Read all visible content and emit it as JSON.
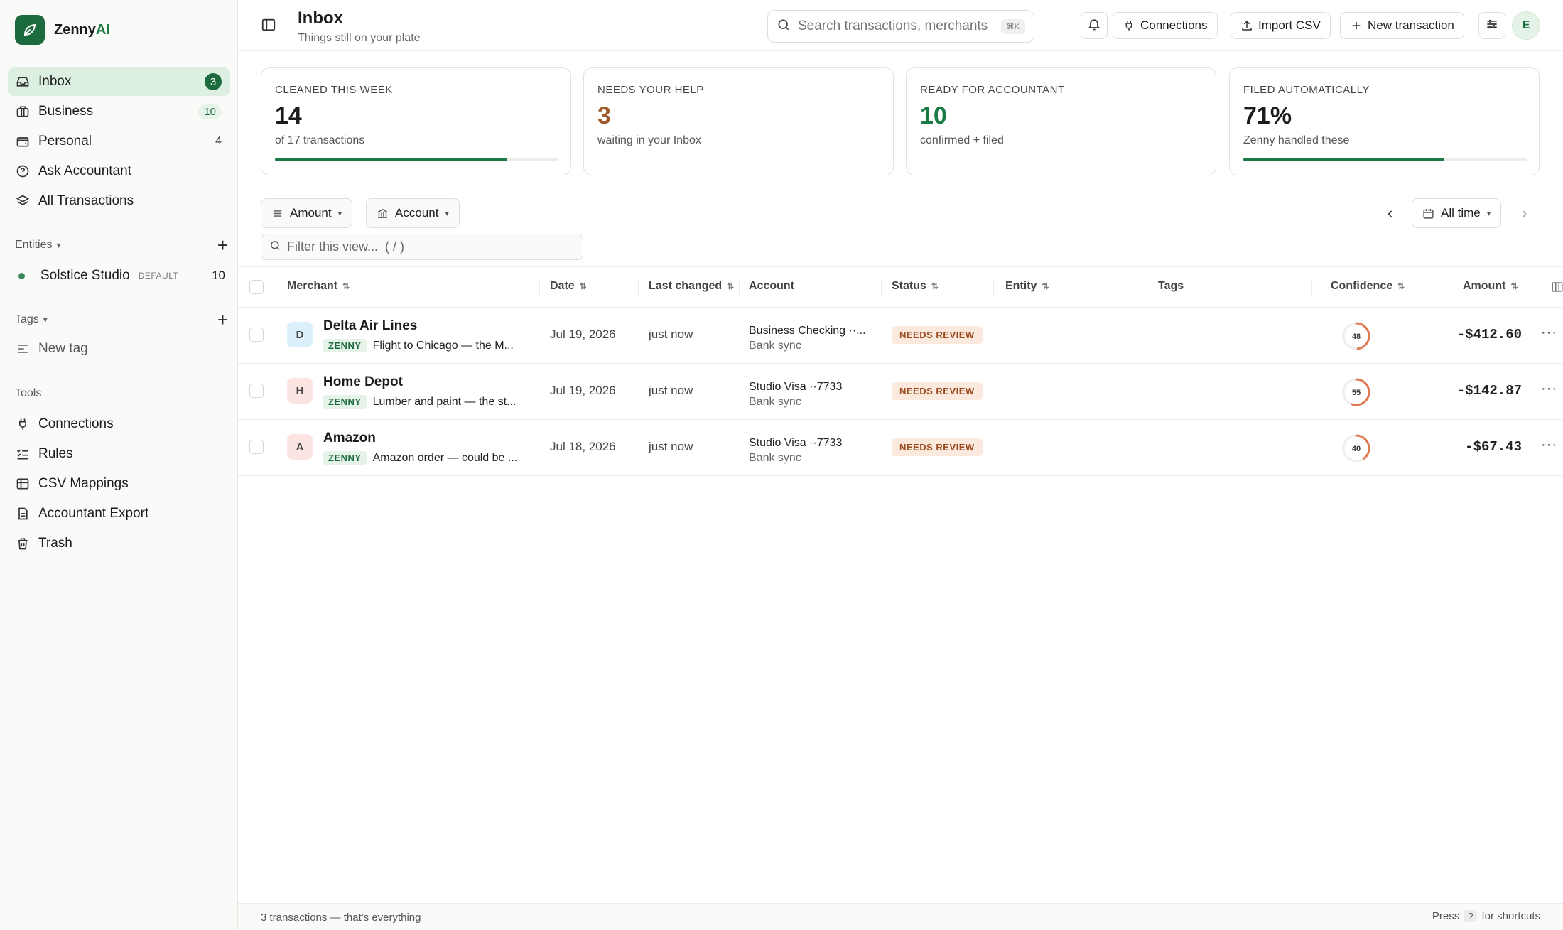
{
  "brand": {
    "name_prefix": "Zenny",
    "name_suffix": "AI"
  },
  "sidebar": {
    "nav": [
      {
        "label": "Inbox",
        "count": "3",
        "icon": "inbox-icon",
        "active": true
      },
      {
        "label": "Business",
        "count": "10",
        "icon": "briefcase-icon"
      },
      {
        "label": "Personal",
        "count": "4",
        "icon": "wallet-icon"
      },
      {
        "label": "Ask Accountant",
        "count": "",
        "icon": "help-circle-icon"
      },
      {
        "label": "All Transactions",
        "count": "",
        "icon": "layers-icon"
      }
    ],
    "entities_heading": "Entities",
    "entities": [
      {
        "name": "Solstice Studio",
        "tag": "DEFAULT",
        "count": "10"
      }
    ],
    "tags_heading": "Tags",
    "new_tag": "New tag",
    "tools_heading": "Tools",
    "tools": [
      {
        "label": "Connections",
        "icon": "plug-icon"
      },
      {
        "label": "Rules",
        "icon": "list-check-icon"
      },
      {
        "label": "CSV Mappings",
        "icon": "table-icon"
      },
      {
        "label": "Accountant Export",
        "icon": "file-icon"
      },
      {
        "label": "Trash",
        "icon": "trash-icon"
      }
    ]
  },
  "header": {
    "title": "Inbox",
    "subtitle": "Things still on your plate",
    "search_placeholder": "Search transactions, merchants",
    "search_kbd": "⌘K",
    "connections": "Connections",
    "import_csv": "Import CSV",
    "new_transaction": "New transaction",
    "avatar": "E"
  },
  "stats": [
    {
      "label": "CLEANED THIS WEEK",
      "value": "14",
      "sub": "of 17 transactions",
      "progress": 0.82,
      "value_color": "#1c1c1c"
    },
    {
      "label": "NEEDS YOUR HELP",
      "value": "3",
      "sub": "waiting in your Inbox",
      "value_color": "#a05a2c"
    },
    {
      "label": "READY FOR ACCOUNTANT",
      "value": "10",
      "sub": "confirmed + filed",
      "value_color": "#1b7a44"
    },
    {
      "label": "FILED AUTOMATICALLY",
      "value": "71%",
      "sub": "Zenny handled these",
      "progress": 0.71,
      "value_color": "#1c1c1c"
    }
  ],
  "filters": {
    "amount": "Amount",
    "account": "Account",
    "filter_placeholder": "Filter this view...  ( / )",
    "range": "All time"
  },
  "table": {
    "columns": {
      "merchant": "Merchant",
      "date": "Date",
      "last_changed": "Last changed",
      "account": "Account",
      "status": "Status",
      "entity": "Entity",
      "tags": "Tags",
      "confidence": "Confidence",
      "amount": "Amount"
    },
    "rows": [
      {
        "initial": "D",
        "avatar_bg": "#dcf0fb",
        "merchant": "Delta Air Lines",
        "tag": "ZENNY",
        "desc": "Flight to Chicago — the M...",
        "date": "Jul 19, 2026",
        "changed": "just now",
        "account": "Business Checking ··...",
        "source": "Bank sync",
        "status": "NEEDS REVIEW",
        "confidence": "48",
        "confidence_level": 0.48,
        "amount": "-$412.60"
      },
      {
        "initial": "H",
        "avatar_bg": "#fbe4e2",
        "merchant": "Home Depot",
        "tag": "ZENNY",
        "desc": "Lumber and paint — the st...",
        "date": "Jul 19, 2026",
        "changed": "just now",
        "account": "Studio Visa ··7733",
        "source": "Bank sync",
        "status": "NEEDS REVIEW",
        "confidence": "55",
        "confidence_level": 0.55,
        "amount": "-$142.87"
      },
      {
        "initial": "A",
        "avatar_bg": "#fbe4e2",
        "merchant": "Amazon",
        "tag": "ZENNY",
        "desc": "Amazon order — could be ...",
        "date": "Jul 18, 2026",
        "changed": "just now",
        "account": "Studio Visa ··7733",
        "source": "Bank sync",
        "status": "NEEDS REVIEW",
        "confidence": "40",
        "confidence_level": 0.4,
        "amount": "-$67.43"
      }
    ]
  },
  "footer": {
    "summary": "3 transactions — that's everything",
    "press": "Press",
    "key": "?",
    "shortcuts": "for shortcuts"
  }
}
